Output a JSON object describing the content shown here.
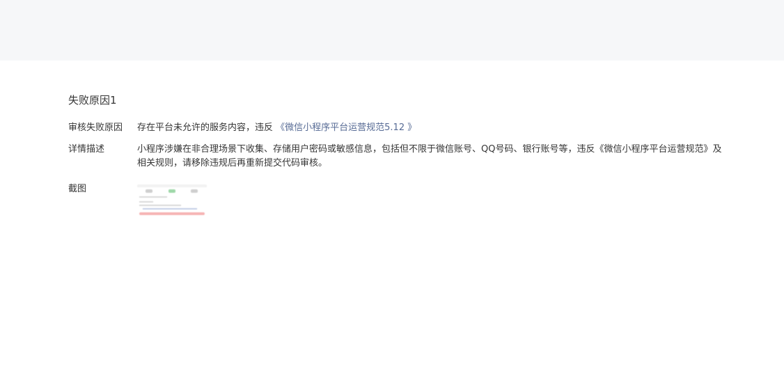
{
  "section": {
    "title": "失败原因1"
  },
  "reason": {
    "label": "审核失败原因",
    "text": "存在平台未允许的服务内容，违反",
    "link": "《微信小程序平台运营规范5.12 》"
  },
  "detail": {
    "label": "详情描述",
    "text": "小程序涉嫌在非合理场景下收集、存储用户密码或敏感信息，包括但不限于微信账号、QQ号码、银行账号等，违反《微信小程序平台运营规范》及相关规则，请移除违规后再重新提交代码审核。"
  },
  "screenshot": {
    "label": "截图"
  },
  "colors": {
    "link": "#576b95",
    "top_band": "#f6f7f9",
    "text": "#353535"
  }
}
